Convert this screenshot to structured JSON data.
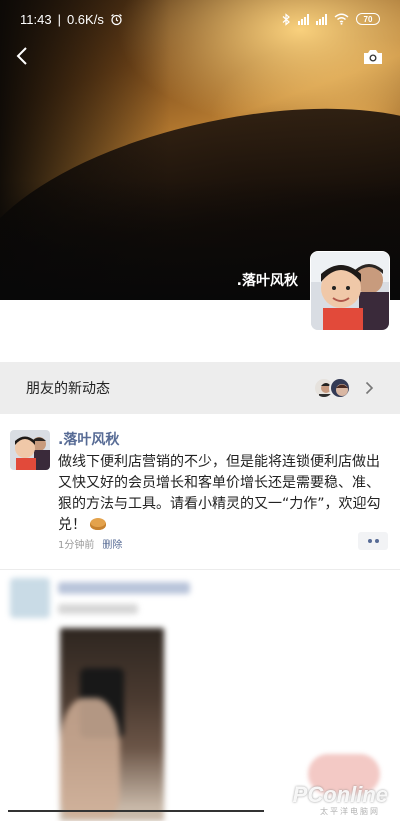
{
  "status_bar": {
    "time": "11:43",
    "network_speed": "0.6K/s",
    "battery": "70"
  },
  "profile": {
    "name": ".落叶风秋"
  },
  "friends_activity": {
    "label": "朋友的新动态"
  },
  "post": {
    "author": ".落叶风秋",
    "text": "做线下便利店营销的不少，但是能将连锁便利店做出又快又好的会员增长和客单价增长还是需要稳、准、狠的方法与工具。请看小精灵的又一“力作”，欢迎勾兑！",
    "time_ago": "1分钟前",
    "delete_label": "删除"
  },
  "watermark": {
    "brand": "PConline",
    "sub": "太平洋电脑网"
  },
  "colors": {
    "link_blue": "#576b95",
    "bar_gray": "#ededed"
  }
}
